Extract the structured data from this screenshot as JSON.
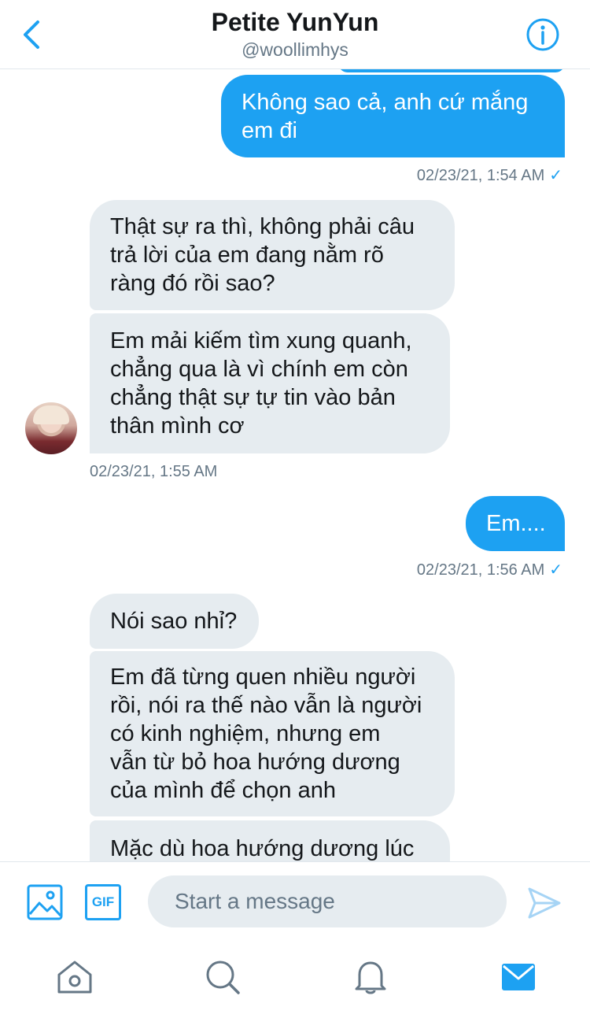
{
  "header": {
    "title": "Petite YunYun",
    "handle": "@woollimhys",
    "back_icon": "chevron-left-icon",
    "info_icon": "info-circle-icon"
  },
  "messages": [
    {
      "side": "sent",
      "lines": [
        "Không sao cả, anh cứ mắng",
        "em đi"
      ]
    },
    {
      "side": "sent_meta",
      "text": "02/23/21, 1:54 AM",
      "check": "✓"
    },
    {
      "side": "recv",
      "lines": [
        "Thật sự ra thì, không phải câu",
        "trả lời của em đang nằm rõ",
        "ràng đó rồi sao?"
      ]
    },
    {
      "side": "recv",
      "lines": [
        "Em mải kiếm tìm xung quanh,",
        "chẳng qua là vì chính em còn",
        "chẳng thật sự tự tin vào bản",
        "thân mình cơ"
      ]
    },
    {
      "side": "recv_meta",
      "text": "02/23/21, 1:55 AM"
    },
    {
      "side": "sent",
      "lines": [
        "Em...."
      ]
    },
    {
      "side": "sent_meta",
      "text": "02/23/21, 1:56 AM",
      "check": "✓"
    },
    {
      "side": "recv",
      "lines": [
        "Nói sao nhỉ?"
      ]
    },
    {
      "side": "recv",
      "lines": [
        "Em đã từng quen nhiều người",
        "rồi, nói ra thế nào vẫn là người",
        "có kinh nghiệm, nhưng em",
        "vẫn từ bỏ hoa hướng dương",
        "của mình để chọn anh"
      ]
    },
    {
      "side": "recv",
      "lines": [
        "Mặc dù hoa hướng dương lúc"
      ]
    }
  ],
  "composer": {
    "placeholder": "Start a message",
    "image_icon": "image-icon",
    "gif_label": "GIF",
    "send_icon": "send-icon"
  },
  "tabs": [
    {
      "name": "home-icon"
    },
    {
      "name": "search-icon"
    },
    {
      "name": "notifications-icon"
    },
    {
      "name": "messages-icon",
      "active": true
    }
  ],
  "colors": {
    "accent": "#1da1f2",
    "bubble_received": "#e6ecf0",
    "meta_text": "#657786"
  }
}
